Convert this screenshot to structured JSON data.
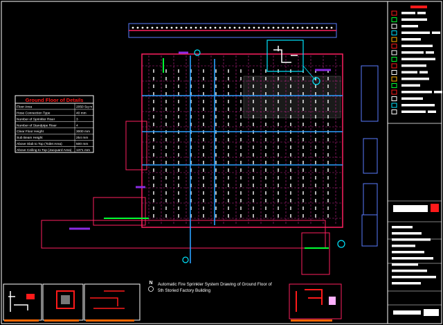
{
  "table": {
    "title": "Ground Floor of Details",
    "rows": [
      {
        "label": "Floor Area",
        "value": "2050 Sq m"
      },
      {
        "label": "Hose Connection Type",
        "value": "40 mm"
      },
      {
        "label": "Number of Sprinkler Riser",
        "value": "3"
      },
      {
        "label": "Number of Standpipe Riser",
        "value": "4"
      },
      {
        "label": "Clear Floor Height",
        "value": "3000 mm"
      },
      {
        "label": "Sub Beam Height",
        "value": "254 mm"
      },
      {
        "label": "Above Slab to Top (Toilet Area)",
        "value": "500 mm"
      },
      {
        "label": "Above Ceiling to Top (Jacquard Area)",
        "value": "1371 mm"
      }
    ]
  },
  "drawing": {
    "north_label": "N",
    "title_line1": "Automatic Fire Sprinkler System Drawing of Ground Floor of",
    "title_line2": "5th Storied Factory Building"
  },
  "colors": {
    "background": "#000000",
    "wall": "#ff2060",
    "grid": "#c0208a",
    "main_pipe": "#2aa0ff",
    "sprinkler": "#ffffff",
    "riser": "#00e6ff",
    "legend_red": "#ff1a1a",
    "accent_purple": "#8a2be2",
    "green": "#00ff33"
  }
}
